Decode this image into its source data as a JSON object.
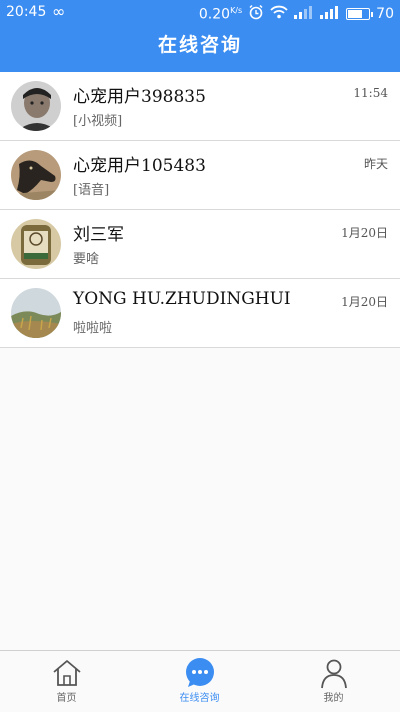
{
  "status_bar": {
    "time": "20:45",
    "speed": "0.20",
    "speed_unit": "K/s",
    "battery": "70"
  },
  "header": {
    "title": "在线咨询"
  },
  "conversations": [
    {
      "name": "心宠用户398835",
      "preview": "[小视频]",
      "time": "11:54",
      "avatar": "man-photo"
    },
    {
      "name": "心宠用户105483",
      "preview": "[语音]",
      "time": "昨天",
      "avatar": "dog-photo"
    },
    {
      "name": "刘三军",
      "preview": "要啥",
      "time": "1月20日",
      "avatar": "jar-photo"
    },
    {
      "name": "YONG HU.ZHUDINGHUI",
      "preview": "啦啦啦",
      "time": "1月20日",
      "avatar": "landscape-photo"
    }
  ],
  "tabbar": {
    "items": [
      {
        "label": "首页",
        "icon": "home-icon"
      },
      {
        "label": "在线咨询",
        "icon": "chat-icon",
        "active": true
      },
      {
        "label": "我的",
        "icon": "user-icon"
      }
    ]
  },
  "colors": {
    "primary": "#3b8df2",
    "divider": "#d9d9d9",
    "background": "#fafafa"
  }
}
